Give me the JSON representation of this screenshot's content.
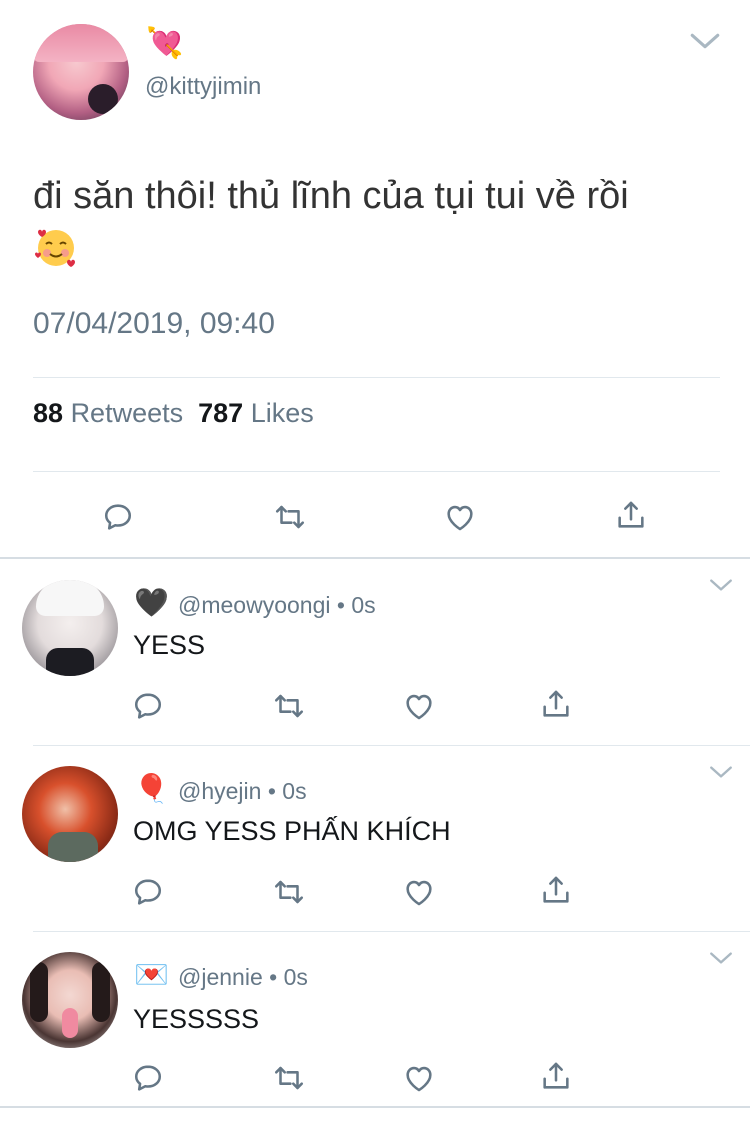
{
  "main_tweet": {
    "handle": "@kittyjimin",
    "name_emoji": "💘",
    "text": "đi săn thôi! thủ lĩnh của tụi tui về rồi",
    "emoji_icon": "smiling-face-with-hearts-icon",
    "timestamp": "07/04/2019, 09:40",
    "retweets": "88",
    "retweets_label": "Retweets",
    "likes": "787",
    "likes_label": "Likes"
  },
  "replies": [
    {
      "name_emoji": "🖤",
      "handle": "@meowyoongi",
      "time": "• 0s",
      "text": "YESS"
    },
    {
      "name_emoji": "🎈",
      "handle": "@hyejin",
      "time": "• 0s",
      "text": "OMG YESS PHẤN KHÍCH"
    },
    {
      "name_emoji": "💌",
      "handle": "@jennie",
      "time": "• 0s",
      "text": "YESSSSS"
    }
  ],
  "colors": {
    "text_primary": "#14171a",
    "text_secondary": "#657786",
    "divider": "#e1e8ed"
  },
  "icons": [
    "reply-icon",
    "retweet-icon",
    "like-icon",
    "share-icon",
    "chevron-down-icon"
  ]
}
